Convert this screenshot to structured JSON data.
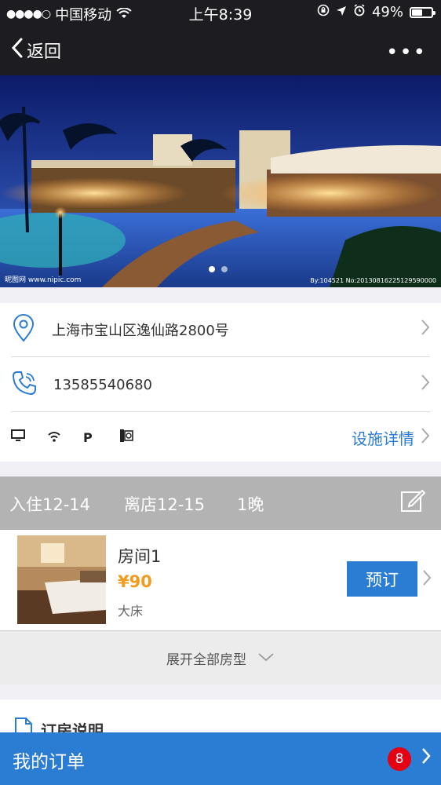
{
  "status_bar": {
    "signal": "●●●●○",
    "carrier": "中国移动",
    "time": "上午8:39",
    "battery_pct": "49%",
    "battery_level": 0.49
  },
  "nav": {
    "back_label": "返回",
    "more_label": "•••"
  },
  "hero": {
    "watermark_left": "昵图网 www.nipic.com",
    "watermark_right": "By:104521 No:20130816225129590000",
    "pages": 2,
    "current_page": 1
  },
  "info": {
    "address": "上海市宝山区逸仙路2800号",
    "phone": "13585540680",
    "facility_icons": [
      "computer-icon",
      "wifi-icon",
      "parking-icon",
      "restaurant-icon"
    ],
    "facility_parking_label": "P",
    "facility_details_label": "设施详情"
  },
  "dates": {
    "checkin": "入住12-14",
    "checkout": "离店12-15",
    "nights": "1晚"
  },
  "room": {
    "name": "房间1",
    "price": "¥90",
    "bed": "大床",
    "book_label": "预订"
  },
  "expand_label": "展开全部房型",
  "notes_title": "订房说明",
  "order_bar": {
    "label": "我的订单",
    "badge": "8"
  },
  "colors": {
    "accent": "#2b7cd3",
    "price": "#f29b1d",
    "badge": "#e50012",
    "bar": "#1d1c21"
  }
}
